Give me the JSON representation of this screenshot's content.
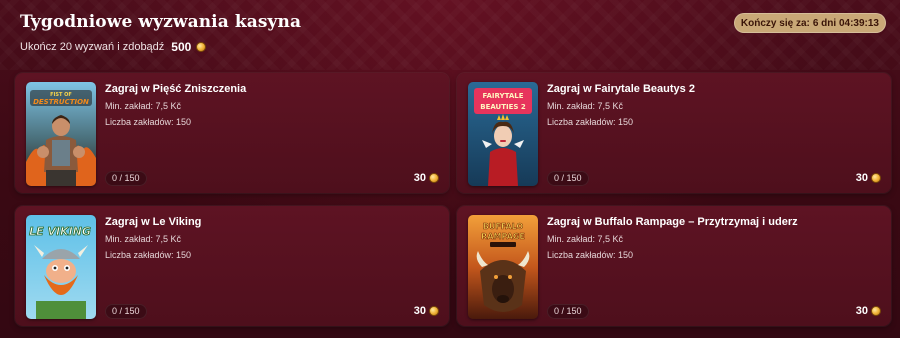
{
  "header": {
    "title": "Tygodniowe wyzwania kasyna",
    "subtitle": "Ukończ 20 wyzwań i zdobądź",
    "reward_amount": "500",
    "timer_label": "Kończy się za:",
    "timer_value": "6 dni 04:39:13"
  },
  "challenges": [
    {
      "title": "Zagraj w Pięść Zniszczenia",
      "min_bet": "Min. zakład: 7,5 Kč",
      "bet_count": "Liczba zakładów: 150",
      "progress": "0 / 150",
      "reward": "30",
      "thumb_text": "FIST OF DESTRUCTION",
      "icon": "fist-of-destruction-thumbnail"
    },
    {
      "title": "Zagraj w Fairytale Beautys 2",
      "min_bet": "Min. zakład: 7,5 Kč",
      "bet_count": "Liczba zakładów: 150",
      "progress": "0 / 150",
      "reward": "30",
      "thumb_text": "FAIRYTALE BEAUTIES 2",
      "icon": "fairytale-beauties-thumbnail"
    },
    {
      "title": "Zagraj w Le Viking",
      "min_bet": "Min. zakład: 7,5 Kč",
      "bet_count": "Liczba zakładów: 150",
      "progress": "0 / 150",
      "reward": "30",
      "thumb_text": "LE VIKING",
      "icon": "le-viking-thumbnail"
    },
    {
      "title": "Zagraj w Buffalo Rampage – Przytrzymaj i uderz",
      "min_bet": "Min. zakład: 7,5 Kč",
      "bet_count": "Liczba zakładów: 150",
      "progress": "0 / 150",
      "reward": "30",
      "thumb_text": "BUFFALO RAMPAGE",
      "icon": "buffalo-rampage-thumbnail"
    }
  ],
  "colors": {
    "background": "#3a0a14",
    "card": "#5e1323",
    "timer_badge": "#c9a877",
    "coin": "#f2b43a"
  }
}
